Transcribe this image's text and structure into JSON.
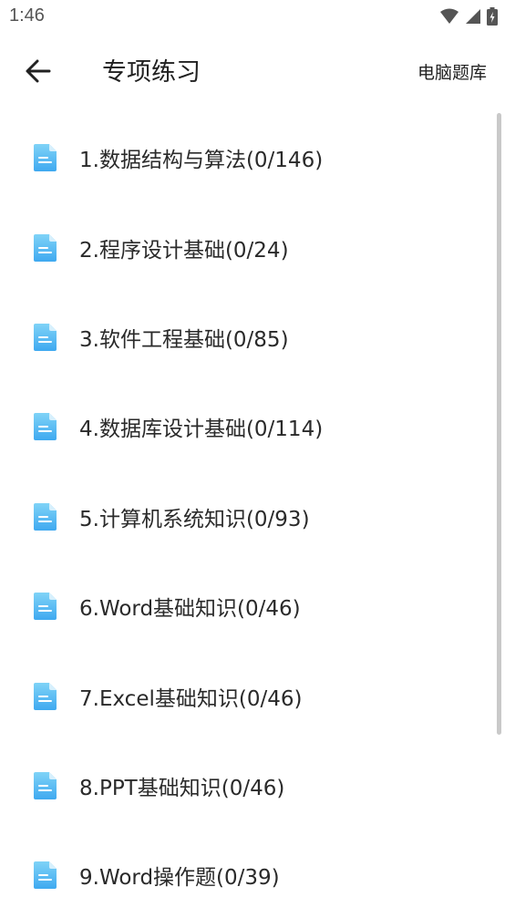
{
  "status_bar": {
    "time": "1:46",
    "icons": [
      "wifi-icon",
      "signal-icon",
      "battery-charging-icon"
    ]
  },
  "app_bar": {
    "back_icon": "arrow-left-icon",
    "title": "专项练习",
    "action_label": "电脑题库"
  },
  "colors": {
    "doc_icon_light": "#7fd3f7",
    "doc_icon_dark": "#3fa9f0",
    "scrollbar": "#c9c9c9"
  },
  "items": [
    {
      "label": "1.数据结构与算法(0/146)",
      "icon": "document-icon"
    },
    {
      "label": "2.程序设计基础(0/24)",
      "icon": "document-icon"
    },
    {
      "label": "3.软件工程基础(0/85)",
      "icon": "document-icon"
    },
    {
      "label": "4.数据库设计基础(0/114)",
      "icon": "document-icon"
    },
    {
      "label": "5.计算机系统知识(0/93)",
      "icon": "document-icon"
    },
    {
      "label": "6.Word基础知识(0/46)",
      "icon": "document-icon"
    },
    {
      "label": "7.Excel基础知识(0/46)",
      "icon": "document-icon"
    },
    {
      "label": "8.PPT基础知识(0/46)",
      "icon": "document-icon"
    },
    {
      "label": "9.Word操作题(0/39)",
      "icon": "document-icon"
    }
  ]
}
